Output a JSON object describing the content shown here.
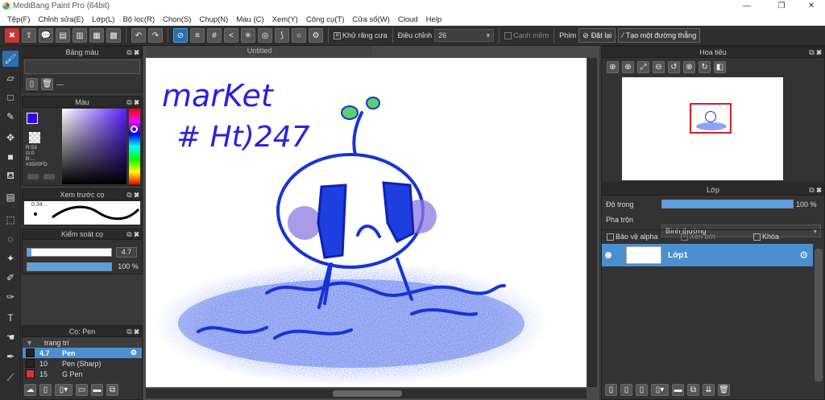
{
  "window": {
    "title": "MediBang Paint Pro (64bit)"
  },
  "menu": [
    "Tệp(F)",
    "Chỉnh sửa(E)",
    "Lớp(L)",
    "Bộ lọc(R)",
    "Chọn(S)",
    "Chụp(N)",
    "Màu (C)",
    "Xem(Y)",
    "Công cụ(T)",
    "Cửa sổ(W)",
    "Cloud",
    "Help"
  ],
  "toolbar": {
    "antialias_label": "Khử răng cưa",
    "adjust_label": "Điều chỉnh",
    "adjust_value": "26",
    "edge_label": "Cạnh mềm",
    "key_label": "Phím",
    "reset_label": "Đặt lại",
    "straight_label": "Tạo một đường thẳng"
  },
  "panels": {
    "palette": {
      "title": "Bảng màu",
      "value": "---"
    },
    "color": {
      "title": "Màu",
      "r": "R:53",
      "g": "G:0",
      "b": "B:...",
      "hex": "#3500FD",
      "main_color": "#3500FD",
      "sub_color": "#ffffff"
    },
    "preview": {
      "title": "Xem trước cọ",
      "size": "0.34..."
    },
    "brush_control": {
      "title": "Kiểm soát cọ",
      "size_value": "4.7",
      "opacity_value": "100 %",
      "size_fraction": 0.047,
      "opacity_fraction": 1.0
    },
    "brush": {
      "title": "Cọ: Pen",
      "group": "trang trí",
      "items": [
        {
          "size": "4.7",
          "name": "Pen",
          "color": "#222222",
          "selected": true
        },
        {
          "size": "10",
          "name": "Pen (Sharp)",
          "color": "#222222",
          "selected": false
        },
        {
          "size": "15",
          "name": "G Pen",
          "color": "#e03030",
          "selected": false
        }
      ]
    }
  },
  "document": {
    "tab": "Untitled"
  },
  "artwork": {
    "text_line1": "marKet",
    "text_line2": "# Ht)247"
  },
  "navigator": {
    "title": "Hoa tiêu"
  },
  "layers": {
    "title": "Lớp",
    "opacity_label": "Độ trong",
    "opacity_value": "100 %",
    "opacity_fraction": 1.0,
    "blend_label": "Pha trộn",
    "blend_value": "Bình thường",
    "protect_alpha": "Bảo vệ alpha",
    "clip": "Xén bớt",
    "lock": "Khóa",
    "items": [
      {
        "name": "Lớp1",
        "selected": true
      }
    ]
  }
}
